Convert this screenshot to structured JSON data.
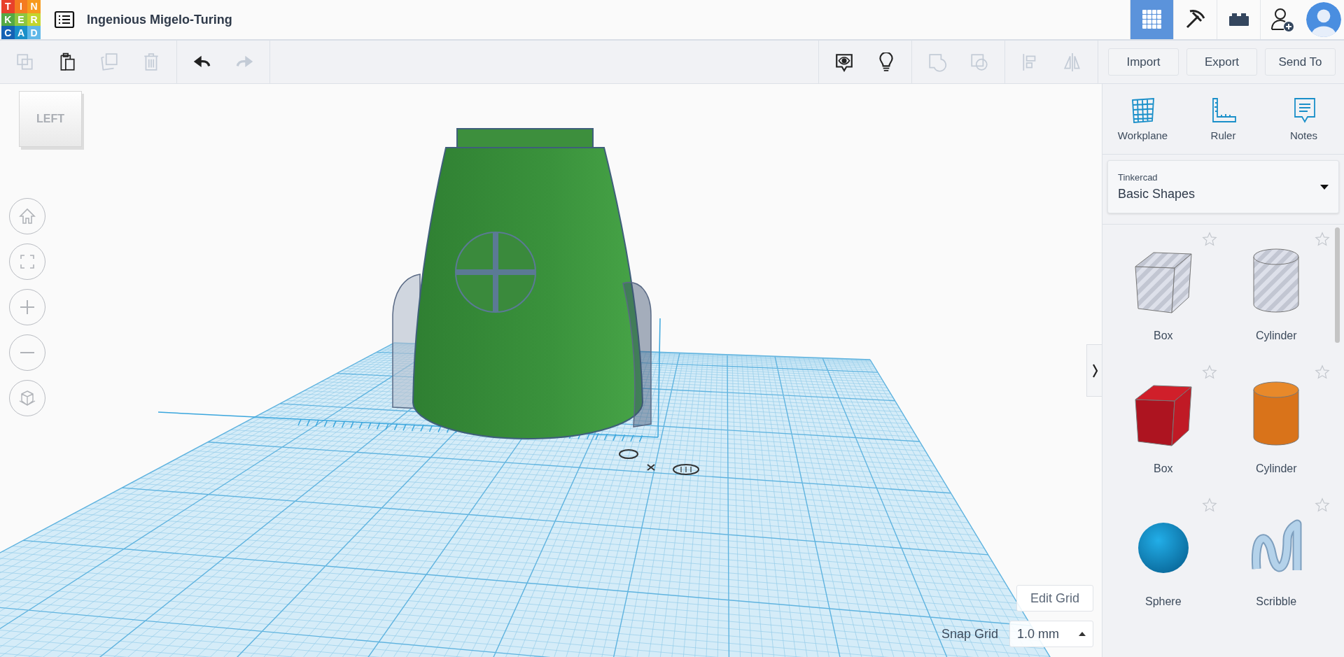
{
  "header": {
    "logo_letters": [
      "T",
      "I",
      "N",
      "K",
      "E",
      "R",
      "C",
      "A",
      "D"
    ],
    "title": "Ingenious Migelo-Turing",
    "nav": [
      {
        "kind": "designs",
        "selected": true
      },
      {
        "kind": "codeblocks",
        "selected": false
      },
      {
        "kind": "bricks",
        "selected": false
      }
    ]
  },
  "toolbar": {
    "left_groups": [
      [
        {
          "kind": "copy",
          "disabled": true
        },
        {
          "kind": "paste",
          "disabled": false
        },
        {
          "kind": "duplicate",
          "disabled": true
        },
        {
          "kind": "delete",
          "disabled": true
        }
      ],
      [
        {
          "kind": "undo",
          "disabled": false
        },
        {
          "kind": "redo",
          "disabled": true
        }
      ]
    ],
    "right_groups": [
      [
        {
          "kind": "notes",
          "disabled": false
        },
        {
          "kind": "hint",
          "disabled": false
        }
      ],
      [
        {
          "kind": "group",
          "disabled": true
        },
        {
          "kind": "ungroup",
          "disabled": true
        }
      ],
      [
        {
          "kind": "align",
          "disabled": true
        },
        {
          "kind": "mirror",
          "disabled": true
        }
      ]
    ],
    "buttons": [
      "Import",
      "Export",
      "Send To"
    ]
  },
  "viewport": {
    "view_cube": "LEFT",
    "edit_grid": "Edit Grid",
    "snap_grid": {
      "label": "Snap Grid",
      "value": "1.0 mm"
    }
  },
  "sidebar": {
    "tools": [
      {
        "kind": "workplane",
        "label": "Workplane"
      },
      {
        "kind": "ruler",
        "label": "Ruler"
      },
      {
        "kind": "notes",
        "label": "Notes"
      }
    ],
    "library": {
      "source": "Tinkercad",
      "name": "Basic Shapes"
    },
    "shapes": [
      {
        "kind": "box-hole",
        "label": "Box",
        "favorite": false
      },
      {
        "kind": "cylinder-hole",
        "label": "Cylinder",
        "favorite": false
      },
      {
        "kind": "box",
        "label": "Box",
        "favorite": false
      },
      {
        "kind": "cylinder",
        "label": "Cylinder",
        "favorite": false
      },
      {
        "kind": "sphere",
        "label": "Sphere",
        "favorite": false
      },
      {
        "kind": "scribble",
        "label": "Scribble",
        "favorite": false
      }
    ]
  }
}
